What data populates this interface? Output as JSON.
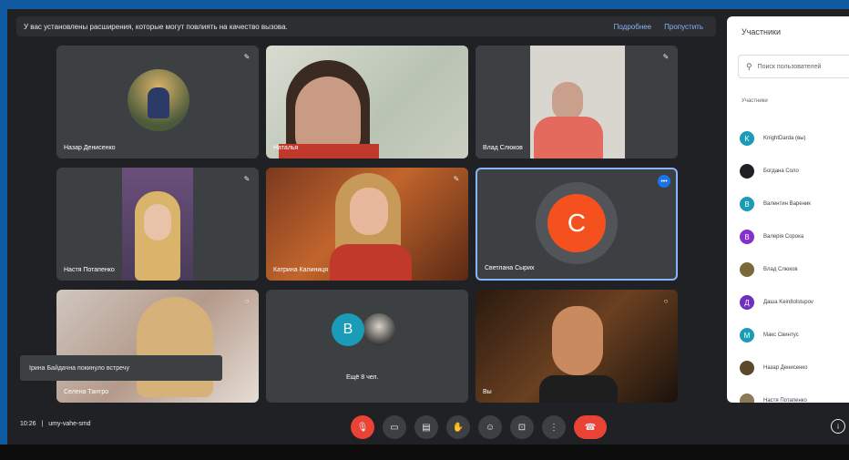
{
  "banner": {
    "message": "У вас установлены расширения, которые могут повлиять на качество вызова.",
    "link_more": "Подробнее",
    "link_dismiss": "Пропустить"
  },
  "tiles": [
    {
      "name": "Назар Денисенко"
    },
    {
      "name": "Наталья"
    },
    {
      "name": "Влад Слюков"
    },
    {
      "name": "Настя Потапенко"
    },
    {
      "name": "Катрина Калиниця"
    },
    {
      "name": "Светлана Сырих",
      "initial": "C"
    },
    {
      "name": "Селена Тантро"
    },
    {
      "name": "Ещё 8 чел.",
      "initial": "B"
    },
    {
      "name": "Вы"
    }
  ],
  "toast": {
    "text": "Ірина Байдачна покинуло встречу"
  },
  "meeting": {
    "time": "10:26",
    "separator": "|",
    "code": "umy-vahe-smd"
  },
  "panel": {
    "title": "Участники",
    "search_placeholder": "Поиск пользователей",
    "section": "Участники",
    "participants": [
      {
        "name": "KnightDarda (вы)",
        "initial": "K",
        "color": "#1a9bb8"
      },
      {
        "name": "Богдана Соло",
        "initial": "",
        "color": "#202124"
      },
      {
        "name": "Валентин Вареник",
        "initial": "В",
        "color": "#1a9bb8"
      },
      {
        "name": "Валерія Сорока",
        "initial": "В",
        "color": "#8430ce"
      },
      {
        "name": "Влад Слюков",
        "initial": "",
        "color": "#7a6a3a"
      },
      {
        "name": "Даша Kein8olstupov",
        "initial": "Д",
        "color": "#6f2fbf"
      },
      {
        "name": "Макс Свинтус",
        "initial": "М",
        "color": "#1a9bb8"
      },
      {
        "name": "Назар Денисенко",
        "initial": "",
        "color": "#5a4a2a"
      },
      {
        "name": "Настя Потапенко",
        "initial": "",
        "color": "#8a7a5a"
      }
    ]
  },
  "colors": {
    "accent": "#8ab4f8",
    "danger": "#ea4335",
    "avatar_orange": "#f4511e",
    "avatar_teal": "#1a9bb8"
  }
}
